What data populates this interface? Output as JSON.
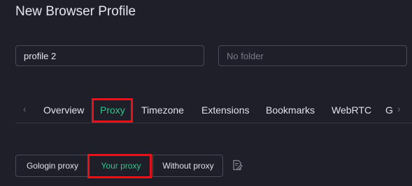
{
  "dialog": {
    "title": "New Browser Profile"
  },
  "form": {
    "profile_name": "profile 2",
    "folder_placeholder": "No folder"
  },
  "tabs": {
    "items": [
      {
        "label": "Overview"
      },
      {
        "label": "Proxy",
        "active": true
      },
      {
        "label": "Timezone"
      },
      {
        "label": "Extensions"
      },
      {
        "label": "Bookmarks"
      },
      {
        "label": "WebRTC"
      },
      {
        "label": "G"
      }
    ],
    "prev_icon": "chevron-left-icon",
    "next_icon": "chevron-right-icon"
  },
  "proxy_mode": {
    "options": [
      {
        "label": "Gologin proxy"
      },
      {
        "label": "Your proxy",
        "selected": true
      },
      {
        "label": "Without proxy"
      }
    ],
    "paste_icon": "edit-document-icon"
  },
  "colors": {
    "background": "#1f1f29",
    "accent": "#2ec48a",
    "highlight": "#e8121a"
  }
}
